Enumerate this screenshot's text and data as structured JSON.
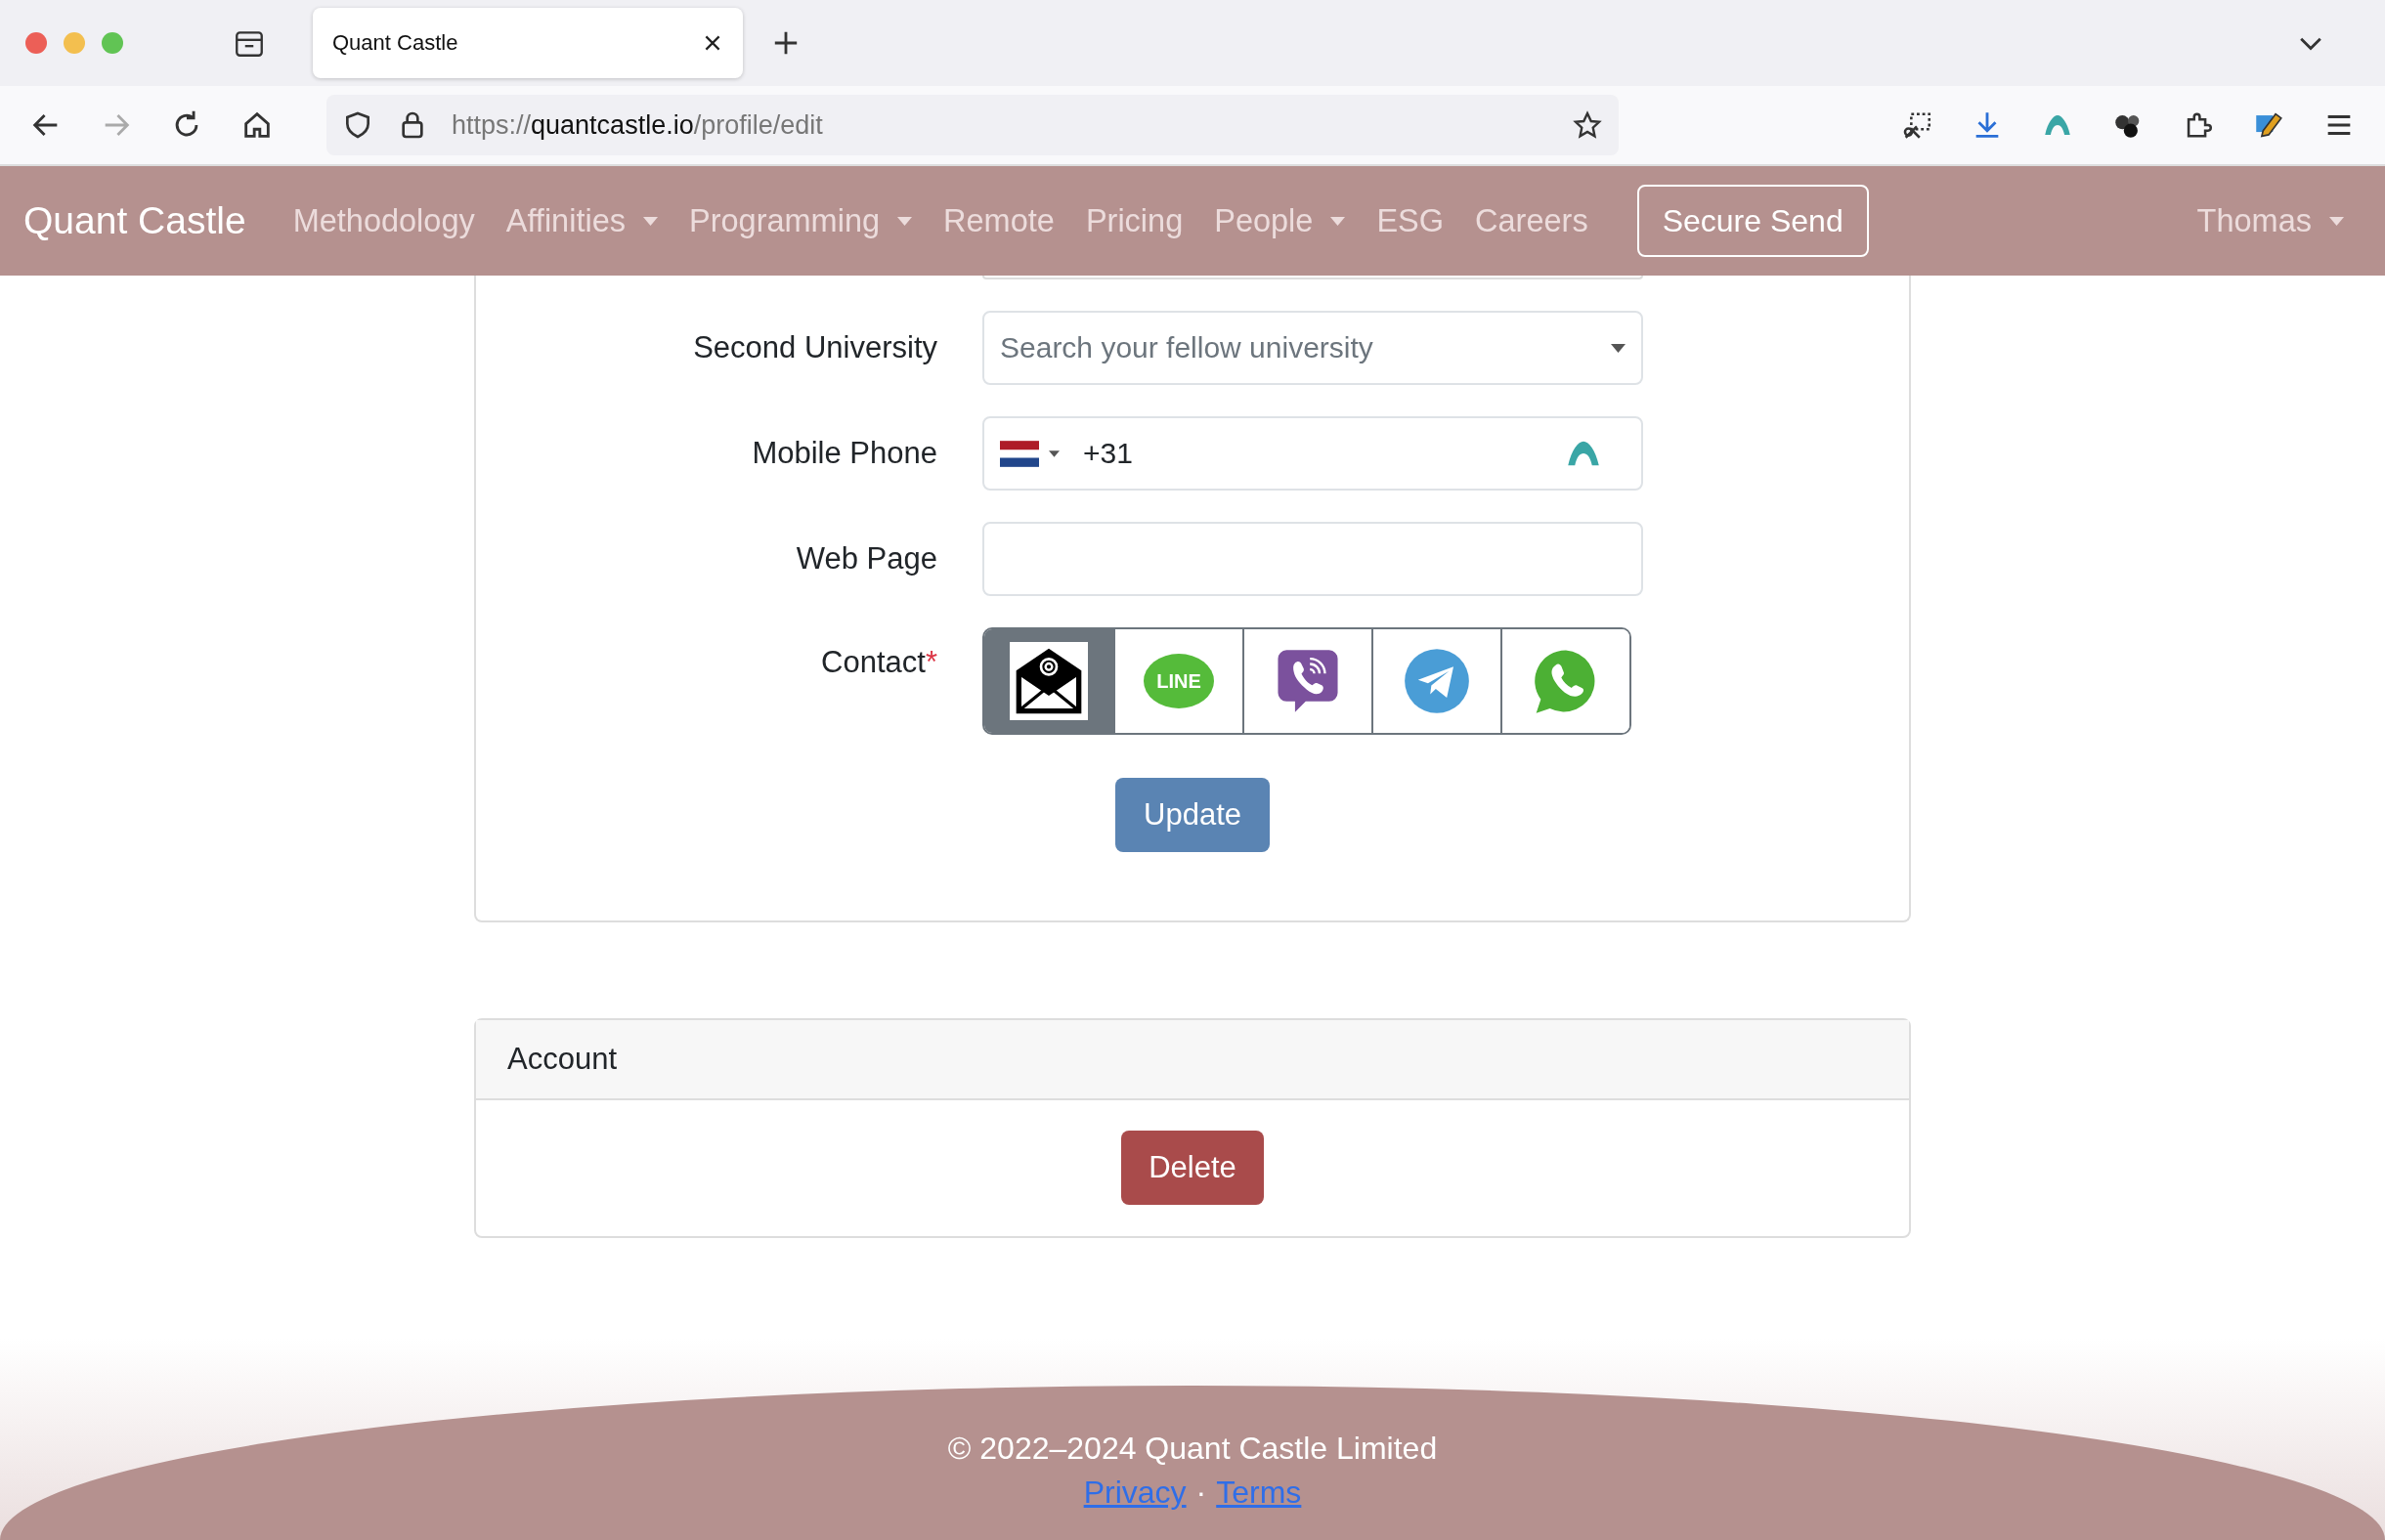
{
  "browser": {
    "tab_title": "Quant Castle",
    "url_scheme": "https://",
    "url_host": "quantcastle.io",
    "url_path": "/profile/edit"
  },
  "navbar": {
    "brand": "Quant Castle",
    "items": [
      {
        "label": "Methodology",
        "dropdown": false
      },
      {
        "label": "Affinities",
        "dropdown": true
      },
      {
        "label": "Programming",
        "dropdown": true
      },
      {
        "label": "Remote",
        "dropdown": false
      },
      {
        "label": "Pricing",
        "dropdown": false
      },
      {
        "label": "People",
        "dropdown": true
      },
      {
        "label": "ESG",
        "dropdown": false
      },
      {
        "label": "Careers",
        "dropdown": false
      }
    ],
    "action_button": "Secure Send",
    "user_menu": "Thomas"
  },
  "form": {
    "fields": [
      {
        "kind": "select",
        "label": "Second University",
        "placeholder": "Search your fellow university"
      },
      {
        "kind": "phone",
        "label": "Mobile Phone",
        "value": "+31"
      },
      {
        "kind": "text",
        "label": "Web Page"
      }
    ],
    "contact": {
      "label": "Contact",
      "required_mark": "*",
      "options": [
        {
          "kind": "email",
          "selected": true
        },
        {
          "kind": "line",
          "selected": false,
          "text": "LINE"
        },
        {
          "kind": "viber",
          "selected": false
        },
        {
          "kind": "telegram",
          "selected": false
        },
        {
          "kind": "whatsapp",
          "selected": false
        }
      ]
    },
    "submit": "Update"
  },
  "account": {
    "title": "Account",
    "delete_button": "Delete"
  },
  "footer": {
    "copyright": "© 2022–2024 Quant Castle Limited",
    "links": [
      "Privacy",
      "Terms"
    ],
    "separator": "·"
  }
}
